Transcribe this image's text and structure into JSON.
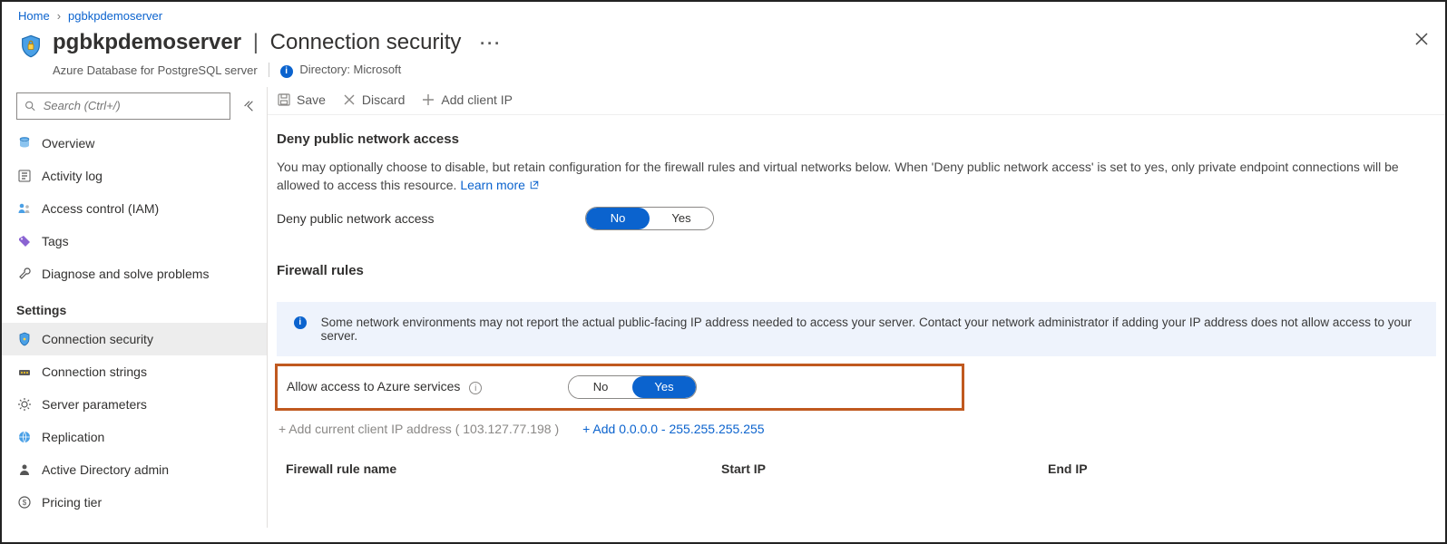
{
  "breadcrumb": {
    "home": "Home",
    "server": "pgbkpdemoserver"
  },
  "title": {
    "name": "pgbkpdemoserver",
    "page": "Connection security",
    "resourceType": "Azure Database for PostgreSQL server",
    "directory_label": "Directory: Microsoft"
  },
  "search": {
    "placeholder": "Search (Ctrl+/)"
  },
  "nav": {
    "overview": "Overview",
    "activity_log": "Activity log",
    "access_control": "Access control (IAM)",
    "tags": "Tags",
    "diagnose": "Diagnose and solve problems",
    "settings_heading": "Settings",
    "connection_security": "Connection security",
    "connection_strings": "Connection strings",
    "server_parameters": "Server parameters",
    "replication": "Replication",
    "ad_admin": "Active Directory admin",
    "pricing_tier": "Pricing tier"
  },
  "toolbar": {
    "save": "Save",
    "discard": "Discard",
    "add_client_ip": "Add client IP"
  },
  "deny": {
    "heading": "Deny public network access",
    "desc_prefix": "You may optionally choose to disable, but retain configuration for the firewall rules and virtual networks below. When 'Deny public network access' is set to yes, only private endpoint connections will be allowed to access this resource. ",
    "learn_more": "Learn more",
    "label": "Deny public network access",
    "no": "No",
    "yes": "Yes",
    "selected": "No"
  },
  "firewall": {
    "heading": "Firewall rules",
    "banner": "Some network environments may not report the actual public-facing IP address needed to access your server.  Contact your network administrator if adding your IP address does not allow access to your server.",
    "allow_label": "Allow access to Azure services",
    "no": "No",
    "yes": "Yes",
    "selected": "Yes",
    "add_current_prefix": "+ Add current client IP address ( ",
    "add_current_ip": "103.127.77.198",
    "add_current_suffix": " )",
    "add_range": "+ Add 0.0.0.0 - 255.255.255.255",
    "col_rule_name": "Firewall rule name",
    "col_start_ip": "Start IP",
    "col_end_ip": "End IP"
  }
}
